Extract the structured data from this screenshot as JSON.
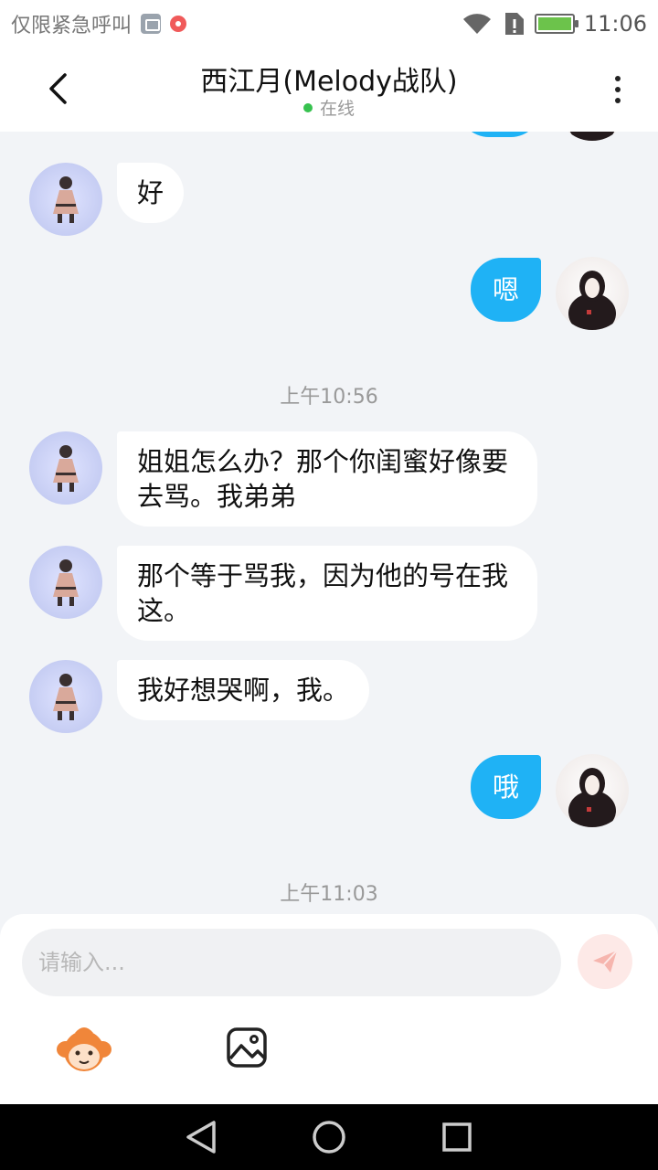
{
  "status_bar": {
    "carrier": "仅限紧急呼叫",
    "time": "11:06"
  },
  "header": {
    "title": "西江月(Melody战队)",
    "status": "在线"
  },
  "messages": [
    {
      "side": "other",
      "text": "好"
    },
    {
      "side": "me",
      "text": "嗯"
    },
    {
      "type": "time",
      "text": "上午10:56"
    },
    {
      "side": "other",
      "text": "姐姐怎么办？那个你闺蜜好像要去骂。我弟弟"
    },
    {
      "side": "other",
      "text": "那个等于骂我，因为他的号在我这。"
    },
    {
      "side": "other",
      "text": "我好想哭啊，我。"
    },
    {
      "side": "me",
      "text": "哦"
    },
    {
      "type": "time",
      "text": "上午11:03"
    }
  ],
  "input": {
    "placeholder": "请输入..."
  },
  "icons": {
    "back": "back-arrow-icon",
    "more": "more-vertical-icon",
    "send": "send-icon",
    "emoji": "emoji-icon",
    "image": "image-icon",
    "nav_back": "nav-back-icon",
    "nav_home": "nav-home-icon",
    "nav_recents": "nav-recents-icon"
  },
  "colors": {
    "accent_bubble": "#1fb2f5",
    "online": "#37c24f",
    "send_bg": "#fde9e7",
    "chat_bg": "#f2f4f7"
  }
}
